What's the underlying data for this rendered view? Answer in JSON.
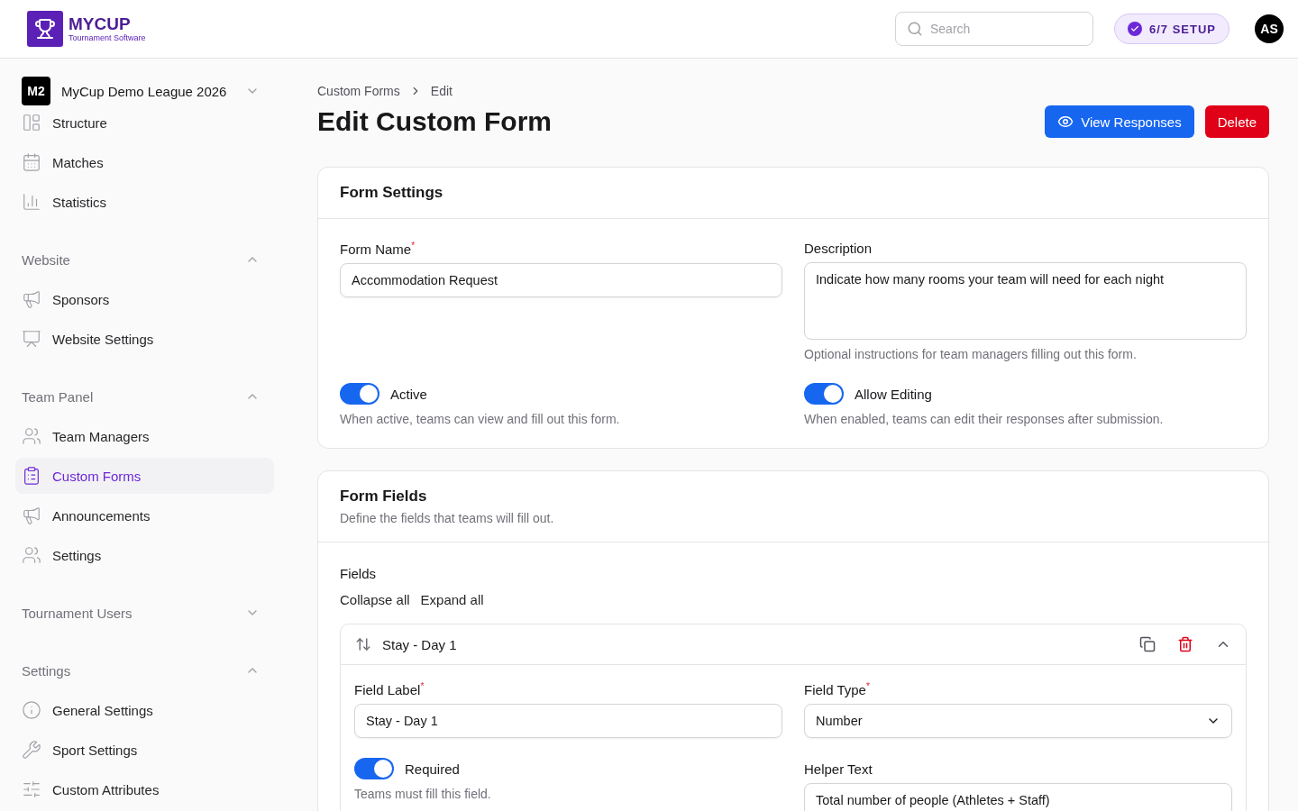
{
  "header": {
    "logo_title": "MYCUP",
    "logo_subtitle": "Tournament Software",
    "search": {
      "placeholder": "Search"
    },
    "setup": "6/7 SETUP",
    "avatar": "AS"
  },
  "sidebar": {
    "league": {
      "badge": "M2",
      "name": "MyCup Demo League 2026",
      "expanded": false
    },
    "league_items": [
      {
        "label": "Structure",
        "selected": false
      },
      {
        "label": "Matches",
        "selected": false
      },
      {
        "label": "Statistics",
        "selected": false
      }
    ],
    "sections": [
      {
        "title": "Website",
        "expanded": true,
        "items": [
          {
            "label": "Sponsors",
            "selected": false
          },
          {
            "label": "Website Settings",
            "selected": false
          }
        ]
      },
      {
        "title": "Team Panel",
        "expanded": true,
        "items": [
          {
            "label": "Team Managers",
            "selected": false
          },
          {
            "label": "Custom Forms",
            "selected": true
          },
          {
            "label": "Announcements",
            "selected": false
          },
          {
            "label": "Settings",
            "selected": false
          }
        ]
      },
      {
        "title": "Tournament Users",
        "expanded": false
      },
      {
        "title": "Settings",
        "expanded": true,
        "items": [
          {
            "label": "General Settings",
            "selected": false
          },
          {
            "label": "Sport Settings",
            "selected": false
          },
          {
            "label": "Custom Attributes",
            "selected": false
          }
        ]
      }
    ]
  },
  "breadcrumb": [
    "Custom Forms",
    "Edit"
  ],
  "page_title": "Edit Custom Form",
  "actions": [
    {
      "kind": "primary",
      "label": "View Responses"
    },
    {
      "kind": "danger",
      "label": "Delete"
    }
  ],
  "form_settings": {
    "title": "Form Settings",
    "form_name": {
      "label": "Form Name$^{*}$",
      "value": "Accommodation Request"
    },
    "description": {
      "label": "Description",
      "value": "Indicate how many rooms your team will need for each night",
      "hint": "Optional instructions for team managers filling out this form."
    },
    "toggles": [
      {
        "label": "Active",
        "on": true,
        "hint": "When active, teams can view and fill out this form."
      },
      {
        "label": "Allow Editing",
        "on": true,
        "hint": "When enabled, teams can edit their responses after submission."
      }
    ]
  },
  "form_fields": {
    "title": "Form Fields",
    "subtitle": "Define the fields that teams will fill out.",
    "fields_label": "Fields",
    "links": [
      "Collapse all",
      "Expand all"
    ],
    "items": [
      {
        "title": "Stay - Day 1",
        "expanded": true,
        "label_field": {
          "label": "Field Label$^{*}$",
          "value": "Stay - Day 1"
        },
        "type_field": {
          "label": "Field Type$^{*}$",
          "value": "Number"
        },
        "required_toggle": {
          "label": "Required",
          "on": true,
          "hint": "Teams must fill this field."
        },
        "helper": {
          "label": "Helper Text",
          "value": "Total number of people (Athletes + Staff)"
        }
      }
    ]
  }
}
